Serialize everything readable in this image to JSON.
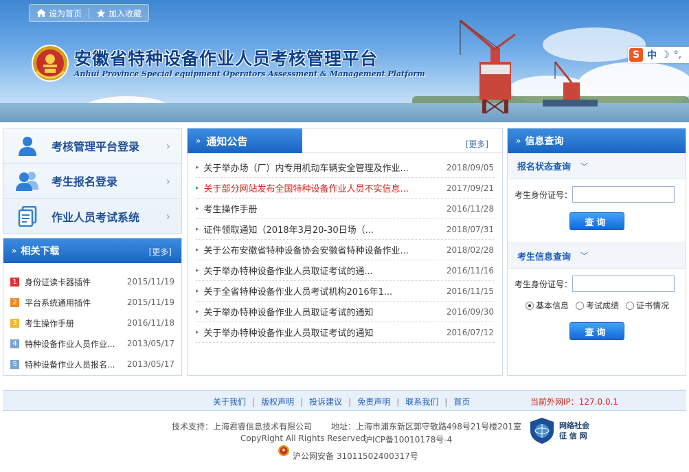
{
  "topbar": {
    "set_home_label": "设为首页",
    "add_favorite_label": "加入收藏"
  },
  "header": {
    "title": "安徽省特种设备作业人员考核管理平台",
    "subtitle": "Anhui Province Special equipment Operators Assessment & Management Platform"
  },
  "ime": {
    "logo": "S",
    "mode": "中",
    "moon": "☽",
    "punct": "°,"
  },
  "login_nav": {
    "items": [
      {
        "label": "考核管理平台登录",
        "icon": "single-user-icon"
      },
      {
        "label": "考生报名登录",
        "icon": "two-users-icon"
      },
      {
        "label": "作业人员考试系统",
        "icon": "documents-icon"
      }
    ],
    "arrow": "›"
  },
  "downloads": {
    "title": "相关下载",
    "more_label": "[更多]",
    "items": [
      {
        "num": "1",
        "name": "身份证读卡器插件",
        "date": "2015/11/19",
        "color": "#e2312d"
      },
      {
        "num": "2",
        "name": "平台系统通用插件",
        "date": "2015/11/19",
        "color": "#f08a24"
      },
      {
        "num": "3",
        "name": "考生操作手册",
        "date": "2016/11/18",
        "color": "#f3b82b"
      },
      {
        "num": "4",
        "name": "特种设备作业人员作业...",
        "date": "2013/05/17",
        "color": "#7aa3d6"
      },
      {
        "num": "5",
        "name": "特种设备作业人员报名...",
        "date": "2013/05/17",
        "color": "#7aa3d6"
      }
    ]
  },
  "notices": {
    "title": "通知公告",
    "more_label": "[更多]",
    "items": [
      {
        "title": "关于举办场（厂）内专用机动车辆安全管理及作业...",
        "date": "2018/09/05",
        "hot": false
      },
      {
        "title": "关于部分网站发布全国特种设备作业人员不实信息...",
        "date": "2017/09/21",
        "hot": true
      },
      {
        "title": "考生操作手册",
        "date": "2016/11/28",
        "hot": false
      },
      {
        "title": "证件领取通知（2018年3月20-30日场（...",
        "date": "2018/07/31",
        "hot": false
      },
      {
        "title": "关于公布安徽省特种设备协会安徽省特种设备作业...",
        "date": "2018/02/28",
        "hot": false
      },
      {
        "title": "关于举办特种设备作业人员取证考试的通...",
        "date": "2016/11/16",
        "hot": false
      },
      {
        "title": "关于全省特种设备作业人员考试机构2016年1...",
        "date": "2016/11/15",
        "hot": false
      },
      {
        "title": "关于举办特种设备作业人员取证考试的通知",
        "date": "2016/09/30",
        "hot": false
      },
      {
        "title": "关于举办特种设备作业人员取证考试的通知",
        "date": "2016/07/12",
        "hot": false
      }
    ]
  },
  "query": {
    "title": "信息查询",
    "status_section": {
      "title": "报名状态查询",
      "id_label": "考生身份证号：",
      "id_value": "",
      "button": "查询"
    },
    "info_section": {
      "title": "考生信息查询",
      "id_label": "考生身份证号：",
      "id_value": "",
      "options": [
        "基本信息",
        "考试成绩",
        "证书情况"
      ],
      "selected": "基本信息",
      "button": "查询"
    }
  },
  "footer": {
    "links": [
      "关于我们",
      "版权声明",
      "投诉建议",
      "免责声明",
      "联系我们",
      "首页"
    ],
    "ip_label": "当前外网IP：127.0.0.1",
    "tech_support": "技术支持：上海君睿信息技术有限公司",
    "address": "地址：上海市浦东新区郭守敬路498号21号楼201室",
    "copyright": "CopyRight All Rights Reserved",
    "icp": "沪ICP备10010178号-4",
    "police_record": "沪公网安备 31011502400317号",
    "credit_badge_line1": "网络社会",
    "credit_badge_line2": "征 信 网"
  },
  "colors": {
    "brand_blue": "#1a64c2",
    "title_blue": "#0c3f8c",
    "hot_red": "#d8211a"
  }
}
